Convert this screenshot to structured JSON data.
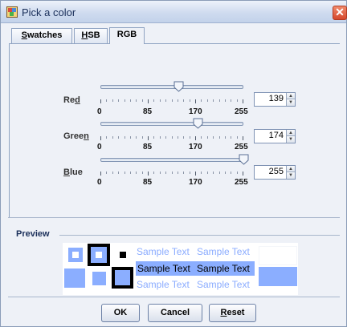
{
  "window": {
    "title": "Pick a color",
    "close_glyph": "✕"
  },
  "tabs": [
    {
      "label": "Swatches",
      "mnemonic": "S",
      "rest": "watches",
      "active": false
    },
    {
      "label": "HSB",
      "mnemonic": "H",
      "rest": "SB",
      "active": false
    },
    {
      "label": "RGB",
      "mnemonic": "",
      "rest": "RGB",
      "active": true
    }
  ],
  "sliders": [
    {
      "name": "red",
      "label_pre": "Re",
      "label_mnemonic": "d",
      "label_post": "",
      "value": "139",
      "fraction": 0.545
    },
    {
      "name": "green",
      "label_pre": "Gree",
      "label_mnemonic": "n",
      "label_post": "",
      "value": "174",
      "fraction": 0.682
    },
    {
      "name": "blue",
      "label_pre": "",
      "label_mnemonic": "B",
      "label_post": "lue",
      "value": "255",
      "fraction": 1.0
    }
  ],
  "tick_labels": [
    "0",
    "85",
    "170",
    "255"
  ],
  "preview": {
    "label": "Preview",
    "sample_text": "Sample Text",
    "selected_color": "#8baeff"
  },
  "buttons": {
    "ok": "OK",
    "cancel": "Cancel",
    "reset_mnemonic": "R",
    "reset_rest": "eset"
  },
  "colors": {
    "accent": "#8baeff",
    "border": "#8fa3c2",
    "title_text": "#1a2f5a"
  },
  "icons": [
    "app-palette-icon",
    "close-icon",
    "spinner-up-icon",
    "spinner-down-icon",
    "slider-thumb-icon"
  ]
}
